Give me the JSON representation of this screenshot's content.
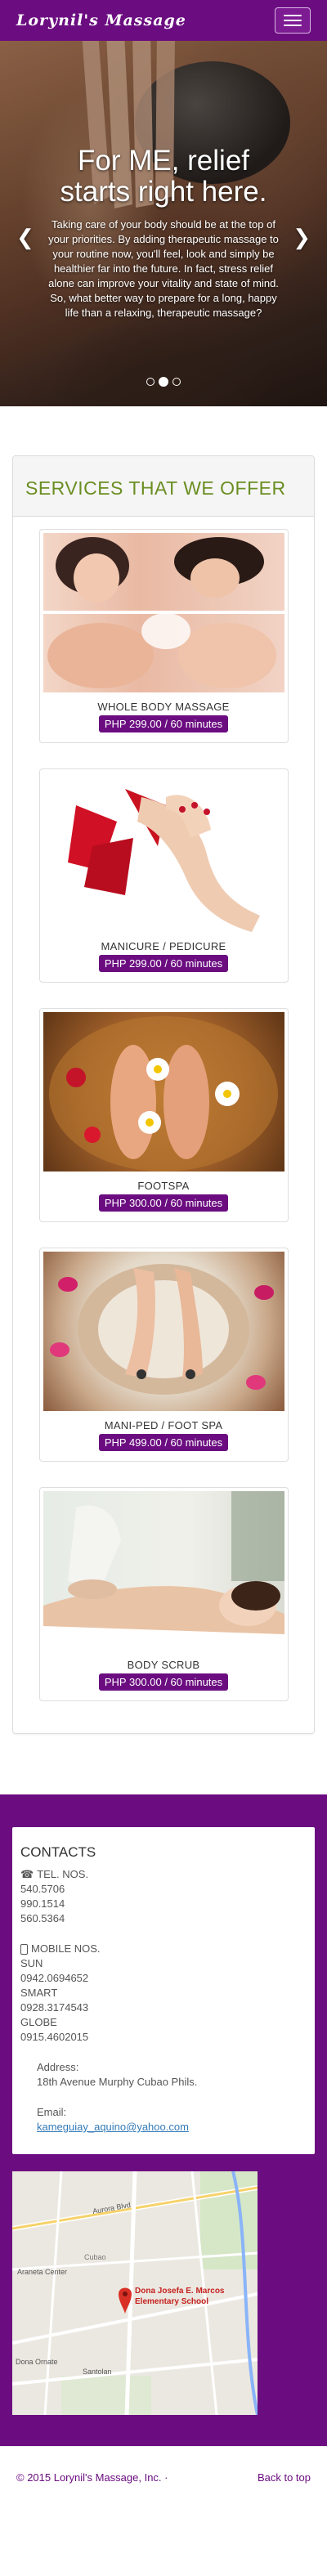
{
  "navbar": {
    "brand": "Lorynil's Massage",
    "toggle_icon": "hamburger-icon"
  },
  "hero": {
    "title": "For ME, relief starts right here.",
    "text": "Taking care of your body should be at the top of your priorities. By adding therapeutic massage to your routine now, you'll feel, look and simply be healthier far into the future. In fact, stress relief alone can improve your vitality and state of mind. So, what better way to prepare for a long, happy life than a relaxing, therapeutic massage?",
    "prev_icon": "chevron-left-icon",
    "next_icon": "chevron-right-icon",
    "slides": 3,
    "active_slide": 2
  },
  "services": {
    "heading": "SERVICES THAT WE OFFER",
    "items": [
      {
        "name": "WHOLE BODY MASSAGE",
        "price": "PHP 299.00 / 60 minutes"
      },
      {
        "name": "MANICURE / PEDICURE",
        "price": "PHP 299.00 / 60 minutes"
      },
      {
        "name": "FOOTSPA",
        "price": "PHP 300.00 / 60 minutes"
      },
      {
        "name": "MANI-PED / FOOT SPA",
        "price": "PHP 499.00 / 60 minutes"
      },
      {
        "name": "BODY SCRUB",
        "price": "PHP 300.00 / 60 minutes"
      }
    ]
  },
  "contacts": {
    "heading": "CONTACTS",
    "tel_label": "TEL. NOS.",
    "tel": [
      "540.5706",
      "990.1514",
      "560.5364"
    ],
    "mobile_label": "MOBILE NOS.",
    "mobile": [
      "SUN",
      "0942.0694652",
      "SMART",
      "0928.3174543",
      "GLOBE",
      "0915.4602015"
    ],
    "address_label": "Address:",
    "address": "18th Avenue Murphy Cubao Phils.",
    "email_label": "Email:",
    "email": "kameguiay_aquino@yahoo.com",
    "map": {
      "place": "Dona Josefa E. Marcos",
      "place2": "Elementary School",
      "labels": [
        "Aurora Blvd",
        "Cubao",
        "Araneta Center",
        "Santolan",
        "Dona Ornate"
      ]
    }
  },
  "footer": {
    "copyright": "© 2015 Lorynil's Massage, Inc. ·",
    "back_to_top": "Back to top"
  },
  "colors": {
    "brand": "#6b0d80",
    "heading_green": "#6b8e23",
    "link": "#337ab7"
  }
}
